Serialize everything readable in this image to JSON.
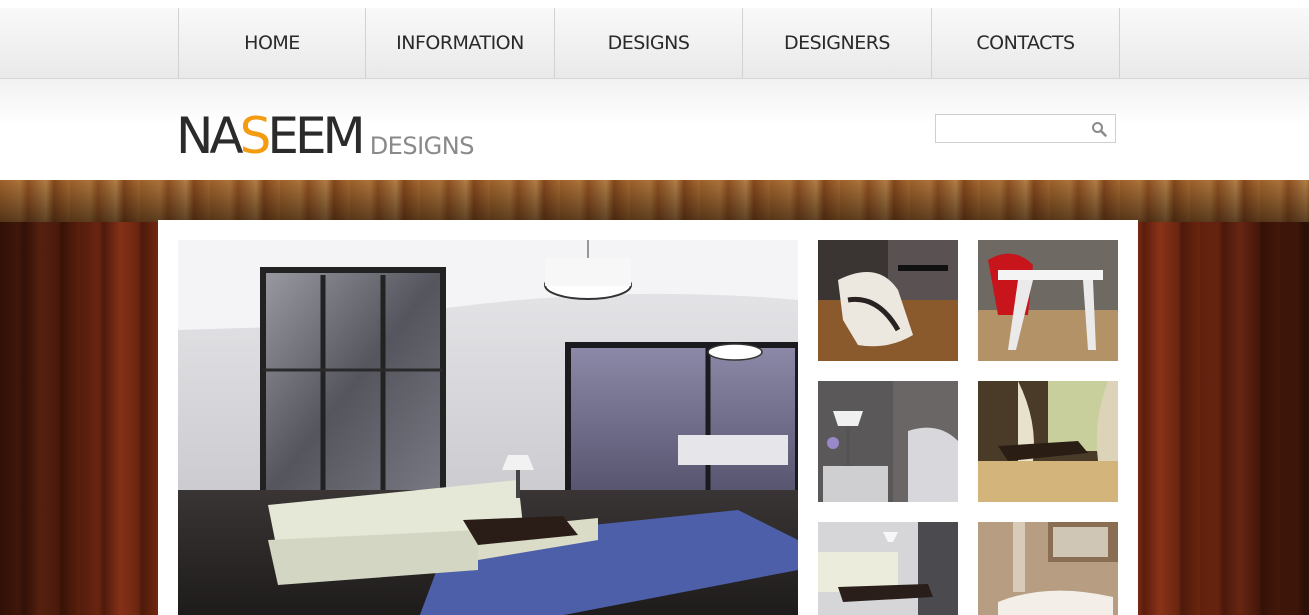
{
  "nav": {
    "items": [
      {
        "label": "HOME"
      },
      {
        "label": "INFORMATION"
      },
      {
        "label": "DESIGNS"
      },
      {
        "label": "DESIGNERS"
      },
      {
        "label": "CONTACTS"
      }
    ]
  },
  "logo": {
    "part1": "NA",
    "accent": "S",
    "part2": "EEM",
    "sub": "DESIGNS",
    "accent_color": "#f39c12"
  },
  "search": {
    "value": "",
    "icon": "search-icon"
  },
  "gallery": {
    "hero": "living-room-photo",
    "thumbnails": [
      "white-lounge-chair-photo",
      "red-chair-white-table-photo",
      "bedroom-lamp-photo",
      "curtained-window-chaise-photo",
      "living-room-sofa-photo",
      "marble-bathroom-photo"
    ]
  }
}
